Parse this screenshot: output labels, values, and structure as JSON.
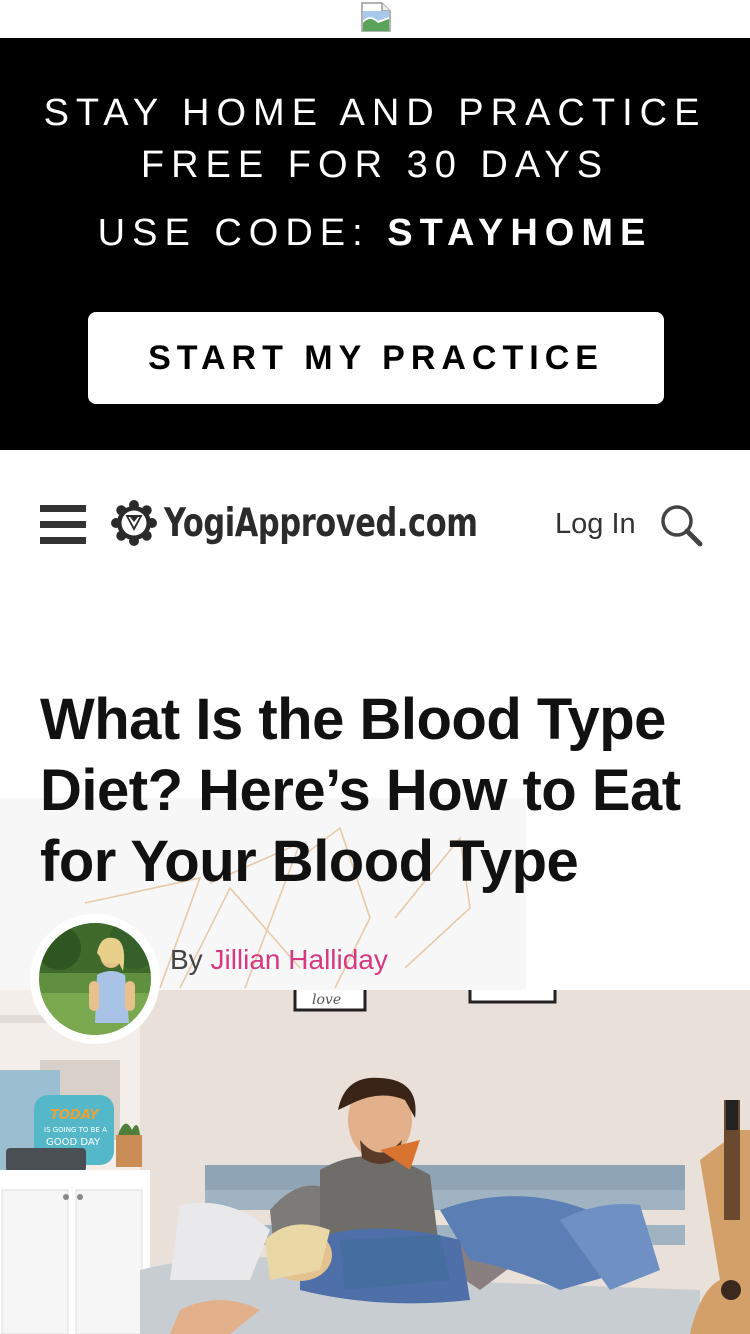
{
  "promo": {
    "line1": "STAY HOME AND PRACTICE",
    "line2": "FREE FOR 30 DAYS",
    "code_prefix": "USE CODE: ",
    "code": "STAYHOME",
    "cta_label": "START MY PRACTICE"
  },
  "header": {
    "logo_text": "YogiApproved.com",
    "login_label": "Log In"
  },
  "article": {
    "title": "What Is the Blood Type Diet? Here’s How to Eat for Your Blood Type",
    "byline_prefix": "By ",
    "author": "Jillian Halliday"
  },
  "photo": {
    "sign_text": [
      "TODAY",
      "IS GOING TO BE A",
      "GOOD DAY"
    ],
    "frame_text": "love"
  },
  "colors": {
    "promo_bg": "#000000",
    "author_link": "#d6397f",
    "text": "#111111"
  }
}
